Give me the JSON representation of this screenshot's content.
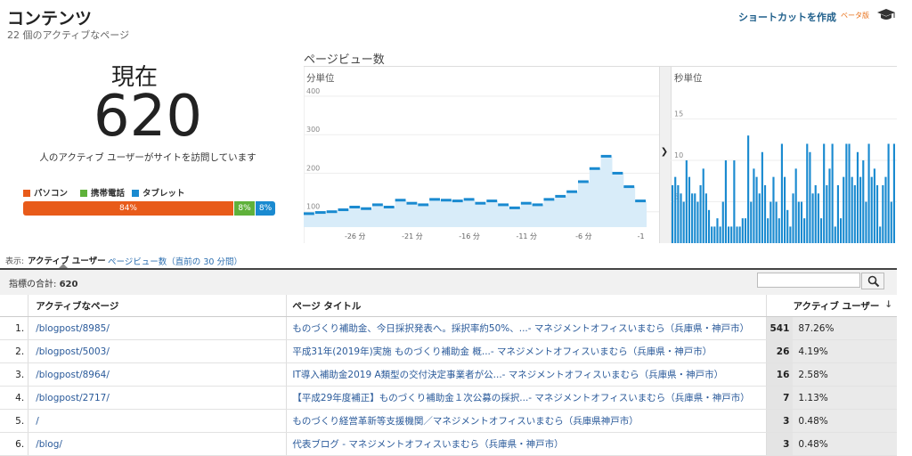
{
  "header": {
    "title": "コンテンツ",
    "subtitle": "22 個のアクティブなページ",
    "shortcut": "ショートカットを作成",
    "beta": "ベータ版"
  },
  "realtime": {
    "label": "現在",
    "count": "620",
    "description": "人のアクティブ ユーザーがサイトを訪問しています"
  },
  "devices": {
    "legend": [
      {
        "label": "パソコン",
        "color": "#e85b1a"
      },
      {
        "label": "携帯電話",
        "color": "#5fb13a"
      },
      {
        "label": "タブレット",
        "color": "#1a8ad0"
      }
    ],
    "desktop_pct": "84%",
    "mobile_pct": "8%",
    "tablet_pct": "8%"
  },
  "pageviews": {
    "title": "ページビュー数",
    "per_minute_label": "分単位",
    "per_second_label": "秒単位"
  },
  "chart_data": [
    {
      "type": "area",
      "title": "分単位",
      "x_ticks": [
        "-26 分",
        "-21 分",
        "-16 分",
        "-11 分",
        "-6 分",
        "-1"
      ],
      "y_ticks": [
        "100",
        "200",
        "300",
        "400"
      ],
      "ylim": [
        60,
        430
      ],
      "x": [
        -30,
        -29,
        -28,
        -27,
        -26,
        -25,
        -24,
        -23,
        -22,
        -21,
        -20,
        -19,
        -18,
        -17,
        -16,
        -15,
        -14,
        -13,
        -12,
        -11,
        -10,
        -9,
        -8,
        -7,
        -6,
        -5,
        -4,
        -3,
        -2,
        -1
      ],
      "values": [
        95,
        98,
        100,
        105,
        112,
        108,
        118,
        112,
        130,
        122,
        118,
        132,
        130,
        128,
        132,
        122,
        128,
        118,
        110,
        122,
        118,
        132,
        140,
        152,
        178,
        212,
        244,
        200,
        165,
        128
      ]
    },
    {
      "type": "bar",
      "title": "秒単位",
      "y_ticks": [
        "5",
        "10",
        "15"
      ],
      "ylim": [
        0,
        17
      ],
      "values": [
        7,
        8,
        7,
        6,
        5,
        10,
        8,
        6,
        6,
        5,
        7,
        9,
        6,
        4,
        2,
        2,
        3,
        2,
        5,
        10,
        2,
        2,
        10,
        2,
        2,
        3,
        3,
        13,
        5,
        9,
        8,
        6,
        11,
        7,
        3,
        5,
        8,
        5,
        3,
        12,
        8,
        4,
        2,
        6,
        9,
        5,
        5,
        3,
        12,
        11,
        6,
        7,
        6,
        3,
        12,
        7,
        9,
        12,
        2,
        7,
        3,
        8,
        12,
        12,
        8,
        7,
        11,
        8,
        10,
        5,
        12,
        8,
        9,
        7,
        2,
        7,
        8,
        12,
        5,
        12
      ]
    }
  ],
  "view": {
    "label": "表示:",
    "active_tab": "アクティブ ユーザー",
    "other_tab": "ページビュー数（直前の 30 分間）"
  },
  "summary": {
    "label": "指標の合計:",
    "value": "620"
  },
  "table": {
    "headers": {
      "page": "アクティブなページ",
      "title": "ページ タイトル",
      "users": "アクティブ ユーザー",
      "sort": "↓"
    },
    "rows": [
      {
        "num": "1.",
        "page": "/blogpost/8985/",
        "title": "ものづくり補助金、今日採択発表へ。採択率約50%、...- マネジメントオフィスいまむら（兵庫県・神戸市）",
        "users": "541",
        "pct": "87.26%"
      },
      {
        "num": "2.",
        "page": "/blogpost/5003/",
        "title": "平成31年(2019年)実施 ものづくり補助金 概...- マネジメントオフィスいまむら（兵庫県・神戸市）",
        "users": "26",
        "pct": "4.19%"
      },
      {
        "num": "3.",
        "page": "/blogpost/8964/",
        "title": "IT導入補助金2019 A類型の交付決定事業者が公...- マネジメントオフィスいまむら（兵庫県・神戸市）",
        "users": "16",
        "pct": "2.58%"
      },
      {
        "num": "4.",
        "page": "/blogpost/2717/",
        "title": "【平成29年度補正】ものづくり補助金１次公募の採択...- マネジメントオフィスいまむら（兵庫県・神戸市）",
        "users": "7",
        "pct": "1.13%"
      },
      {
        "num": "5.",
        "page": "/",
        "title": "ものづくり経営革新等支援機関／マネジメントオフィスいまむら（兵庫県神戸市）",
        "users": "3",
        "pct": "0.48%"
      },
      {
        "num": "6.",
        "page": "/blog/",
        "title": "代表ブログ - マネジメントオフィスいまむら（兵庫県・神戸市）",
        "users": "3",
        "pct": "0.48%"
      }
    ]
  }
}
